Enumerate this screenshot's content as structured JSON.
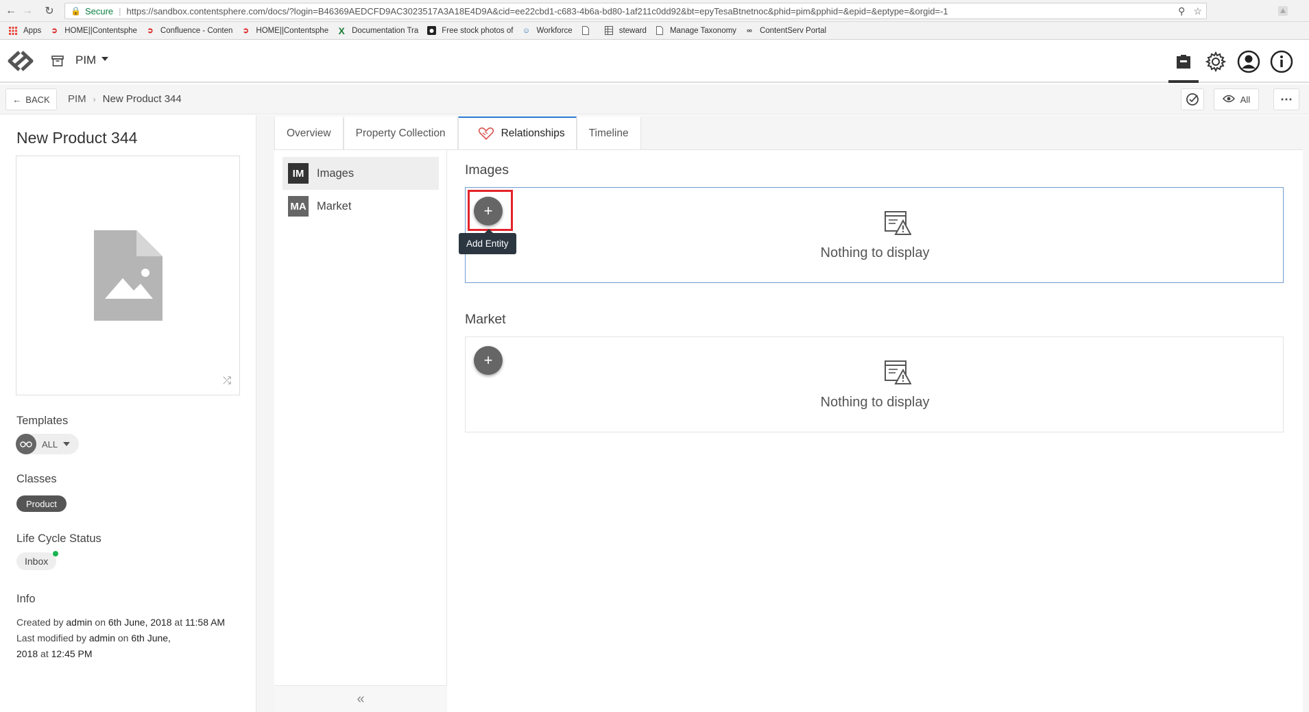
{
  "browser": {
    "secure_label": "Secure",
    "url": "https://sandbox.contentsphere.com/docs/?login=B46369AEDCFD9AC3023517A3A18E4D9A&cid=ee22cbd1-c683-4b6a-bd80-1af211c0dd92&bt=epyTesaBtnetnoc&phid=pim&pphid=&epid=&eptype=&orgid=-1",
    "bookmarks": [
      {
        "label": "Apps",
        "icon": "apps-grid-icon"
      },
      {
        "label": "HOME||Contentsphe",
        "icon": "contentserv-icon"
      },
      {
        "label": "Confluence - Conten",
        "icon": "confluence-icon"
      },
      {
        "label": "HOME||Contentsphe",
        "icon": "contentserv-icon"
      },
      {
        "label": "Documentation Tra",
        "icon": "x-icon"
      },
      {
        "label": "Free stock photos of",
        "icon": "camera-icon"
      },
      {
        "label": "Workforce",
        "icon": "workforce-icon"
      },
      {
        "label": "",
        "icon": "page-icon"
      },
      {
        "label": "steward",
        "icon": "table-icon"
      },
      {
        "label": "Manage Taxonomy",
        "icon": "page-icon"
      },
      {
        "label": "ContentServ Portal",
        "icon": "portal-icon"
      }
    ]
  },
  "header": {
    "module": "PIM"
  },
  "crumbbar": {
    "back": "BACK",
    "crumbs": [
      "PIM",
      "New Product 344"
    ],
    "view_all": "All"
  },
  "left": {
    "title": "New Product 344",
    "templates_label": "Templates",
    "templates_value": "ALL",
    "classes_label": "Classes",
    "class_chip": "Product",
    "lifecycle_label": "Life Cycle Status",
    "lifecycle_value": "Inbox",
    "info_label": "Info",
    "info": {
      "created_prefix": "Created by",
      "created_by": "admin",
      "on1": "on",
      "created_date": "6th June, 2018",
      "at1": "at",
      "created_time": "11:58 AM",
      "modified_prefix": "Last modified by",
      "modified_by": "admin",
      "on2": "on",
      "modified_date_a": "6th June,",
      "modified_date_b": "2018",
      "at2": "at",
      "modified_time": "12:45 PM"
    }
  },
  "tabs": [
    "Overview",
    "Property Collection",
    "Relationships",
    "Timeline"
  ],
  "relationships": {
    "nav": [
      {
        "abbr": "IM",
        "label": "Images",
        "color": "#333333"
      },
      {
        "abbr": "MA",
        "label": "Market",
        "color": "#666666"
      }
    ],
    "sections": [
      {
        "heading": "Images",
        "empty": "Nothing to display"
      },
      {
        "heading": "Market",
        "empty": "Nothing to display"
      }
    ],
    "tooltip": "Add Entity"
  },
  "colors": {
    "accent": "#2a7ad2",
    "highlight": "#e4222a",
    "status_dot": "#17b350"
  }
}
